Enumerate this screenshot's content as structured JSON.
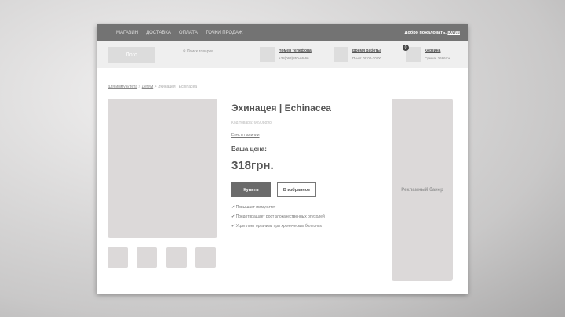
{
  "topbar": {
    "nav": [
      "МАГАЗИН",
      "ДОСТАВКА",
      "ОПЛАТА",
      "ТОЧКИ ПРОДАЖ"
    ],
    "welcome": "Добро пожаловать,",
    "user": "Юлия"
  },
  "header": {
    "logo": "Лого",
    "search_placeholder": "Поиск товаров",
    "phone": {
      "title": "Номер телефона",
      "value": "+38(063)850-66-66"
    },
    "hours": {
      "title": "Время работы",
      "value": "Пн-пт 09:00-20:00"
    },
    "cart": {
      "title": "Корзина",
      "sum": "Сумма: 2686грн.",
      "count": "0"
    }
  },
  "breadcrumb": {
    "items": [
      "Для иммунитета",
      "Детям"
    ],
    "sep": " > ",
    "current": "Эхинацея | Echinacea"
  },
  "product": {
    "title": "Эхинацея | Echinacea",
    "code": "Код товара: 60908898",
    "stock": "Есть в наличии",
    "price_label": "Ваша цена:",
    "price": "318грн.",
    "buy": "Купить",
    "favorite": "В избранное",
    "check": "✔",
    "features": [
      "Повышает иммунитет",
      "Предотвращает рост злокачественных опухолей",
      "Укрепляет организм при хронических болезнях"
    ]
  },
  "banner": "Рекламный банер"
}
